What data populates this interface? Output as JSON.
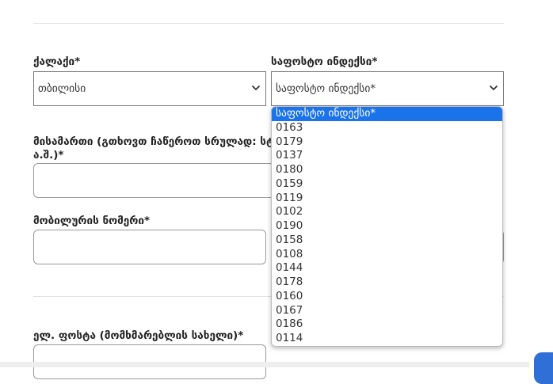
{
  "form": {
    "city": {
      "label": "ქალაქი*",
      "value": "თბილისი"
    },
    "postal": {
      "label": "საფოსტო ინდექსი*",
      "value": "საფოსტო ინდექსი*",
      "options": [
        "საფოსტო ინდექსი*",
        "0163",
        "0179",
        "0137",
        "0180",
        "0159",
        "0119",
        "0102",
        "0190",
        "0158",
        "0108",
        "0144",
        "0178",
        "0160",
        "0167",
        "0186",
        "0114"
      ],
      "selected_index": 0
    },
    "address": {
      "label_line1": "მისამართი (გთხოვთ ჩაწეროთ სრულად: სტ",
      "label_line2": "ა.შ.)*",
      "value": ""
    },
    "mobile": {
      "label": "მობილურის ნომერი*",
      "value": ""
    },
    "email": {
      "label": "ელ. ფოსტა (მომხმარებლის სახელი)*",
      "value": ""
    }
  },
  "icons": {
    "select_chevron": "chevron-down-icon"
  },
  "colors": {
    "selected_option_bg": "#1a73e8",
    "border": "#9a9a9a",
    "accent_button": "#2f6fd6"
  }
}
